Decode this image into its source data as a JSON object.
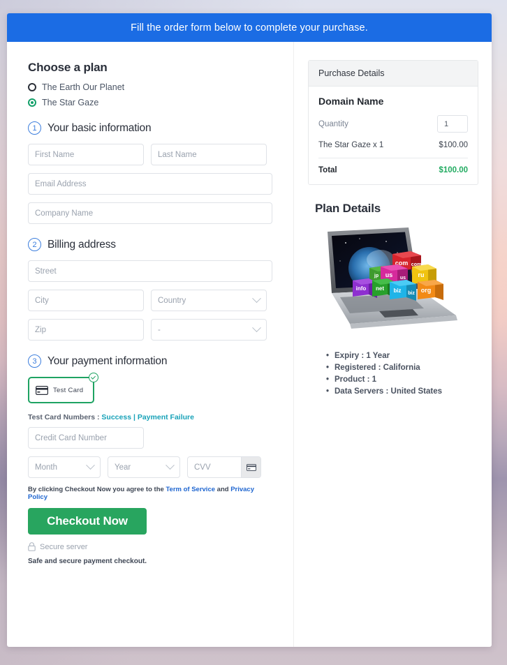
{
  "banner": {
    "text": "Fill the order form below to complete your purchase."
  },
  "plan_section": {
    "title": "Choose a plan",
    "options": [
      {
        "label": "The Earth Our Planet",
        "selected": false
      },
      {
        "label": "The Star Gaze",
        "selected": true
      }
    ]
  },
  "steps": [
    {
      "number": "1",
      "title": "Your basic information"
    },
    {
      "number": "2",
      "title": "Billing address"
    },
    {
      "number": "3",
      "title": "Your payment information"
    }
  ],
  "basic_info": {
    "first_name_placeholder": "First Name",
    "last_name_placeholder": "Last Name",
    "email_placeholder": "Email Address",
    "company_placeholder": "Company Name"
  },
  "billing": {
    "street_placeholder": "Street",
    "city_placeholder": "City",
    "country_placeholder": "Country",
    "zip_placeholder": "Zip",
    "state_placeholder": "-"
  },
  "payment": {
    "tile_label": "Test Card",
    "test_numbers_prefix": "Test Card Numbers :",
    "success_link": "Success",
    "separator": "|",
    "failure_link": "Payment Failure",
    "card_number_placeholder": "Credit Card Number",
    "month_placeholder": "Month",
    "year_placeholder": "Year",
    "cvv_placeholder": "CVV"
  },
  "footer": {
    "agree_prefix": "By clicking Checkout Now you agree to the",
    "terms_link": "Term of Service",
    "agree_mid": "and",
    "privacy_link": "Privacy Policy",
    "checkout_label": "Checkout Now",
    "secure_text": "Secure server",
    "safe_text": "Safe and secure payment checkout."
  },
  "purchase": {
    "header": "Purchase Details",
    "domain_name": "Domain Name",
    "quantity_label": "Quantity",
    "quantity_value": "1",
    "item_label": "The Star Gaze x 1",
    "item_price": "$100.00",
    "total_label": "Total",
    "total_price": "$100.00"
  },
  "plan_details": {
    "title": "Plan Details",
    "bullets": [
      "Expiry : 1 Year",
      "Registered : California",
      "Product : 1",
      "Data Servers : United States"
    ],
    "image_cubes": [
      {
        "label": "com",
        "color": "#d6242c"
      },
      {
        "label": "jp",
        "color": "#3f9b2e"
      },
      {
        "label": "us",
        "color": "#d62a9c"
      },
      {
        "label": "ru",
        "color": "#f0c310"
      },
      {
        "label": "info",
        "color": "#8e2fd0"
      },
      {
        "label": "net",
        "color": "#27a02b"
      },
      {
        "label": "biz",
        "color": "#1fb4e8"
      },
      {
        "label": "org",
        "color": "#f28a16"
      }
    ]
  },
  "colors": {
    "banner_blue": "#1b6ce4",
    "accent_green": "#28a55f",
    "step_blue": "#3b7ddd",
    "link_teal": "#18a2b8"
  }
}
